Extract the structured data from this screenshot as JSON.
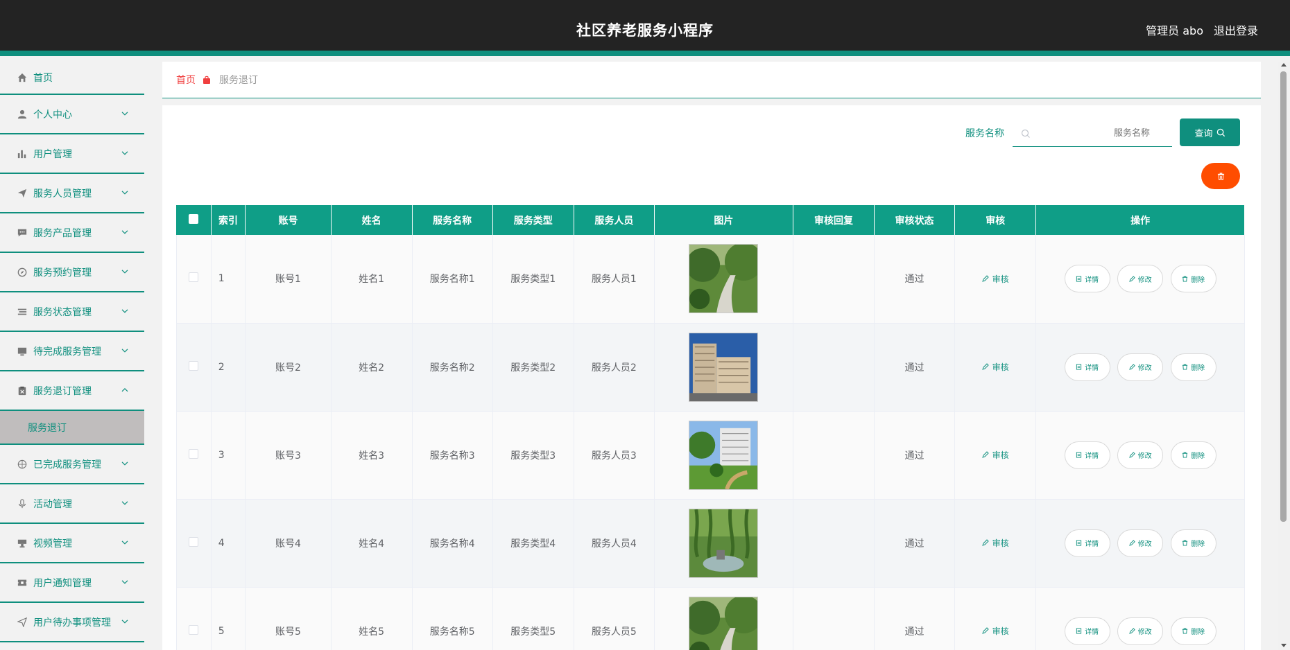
{
  "header": {
    "title": "社区养老服务小程序",
    "user": "管理员 abo",
    "logout": "退出登录"
  },
  "sidebar": {
    "items": [
      {
        "label": "首页",
        "icon": "home-icon"
      },
      {
        "label": "个人中心",
        "icon": "user-icon"
      },
      {
        "label": "用户管理",
        "icon": "bar-chart-icon"
      },
      {
        "label": "服务人员管理",
        "icon": "paper-plane-icon"
      },
      {
        "label": "服务产品管理",
        "icon": "chat-bubble-icon"
      },
      {
        "label": "服务预约管理",
        "icon": "compass-icon"
      },
      {
        "label": "服务状态管理",
        "icon": "list-icon"
      },
      {
        "label": "待完成服务管理",
        "icon": "monitor-icon"
      },
      {
        "label": "服务退订管理",
        "icon": "clipboard-x-icon"
      },
      {
        "label": "已完成服务管理",
        "icon": "aperture-icon"
      },
      {
        "label": "活动管理",
        "icon": "microphone-icon"
      },
      {
        "label": "视频管理",
        "icon": "projector-icon"
      },
      {
        "label": "用户通知管理",
        "icon": "ticket-icon"
      },
      {
        "label": "用户待办事项管理",
        "icon": "send-icon"
      }
    ],
    "subitem": "服务退订"
  },
  "breadcrumb": {
    "home": "首页",
    "current": "服务退订"
  },
  "search": {
    "label": "服务名称",
    "placeholder": "服务名称",
    "button": "查询"
  },
  "table": {
    "columns": [
      "索引",
      "账号",
      "姓名",
      "服务名称",
      "服务类型",
      "服务人员",
      "图片",
      "审核回复",
      "审核状态",
      "审核",
      "操作"
    ],
    "audit_label": "审核",
    "actions": {
      "detail": "详情",
      "edit": "修改",
      "delete": "删除"
    },
    "rows": [
      {
        "index": "1",
        "account": "账号1",
        "name": "姓名1",
        "service": "服务名称1",
        "type": "服务类型1",
        "staff": "服务人员1",
        "reply": "",
        "status": "通过"
      },
      {
        "index": "2",
        "account": "账号2",
        "name": "姓名2",
        "service": "服务名称2",
        "type": "服务类型2",
        "staff": "服务人员2",
        "reply": "",
        "status": "通过"
      },
      {
        "index": "3",
        "account": "账号3",
        "name": "姓名3",
        "service": "服务名称3",
        "type": "服务类型3",
        "staff": "服务人员3",
        "reply": "",
        "status": "通过"
      },
      {
        "index": "4",
        "account": "账号4",
        "name": "姓名4",
        "service": "服务名称4",
        "type": "服务类型4",
        "staff": "服务人员4",
        "reply": "",
        "status": "通过"
      },
      {
        "index": "5",
        "account": "账号5",
        "name": "姓名5",
        "service": "服务名称5",
        "type": "服务类型5",
        "staff": "服务人员5",
        "reply": "",
        "status": "通过"
      }
    ]
  },
  "colors": {
    "accent": "#0f8f7e",
    "table_header": "#0f9e87",
    "danger": "#ff4d00",
    "breadcrumb_home": "#f03f3f"
  }
}
